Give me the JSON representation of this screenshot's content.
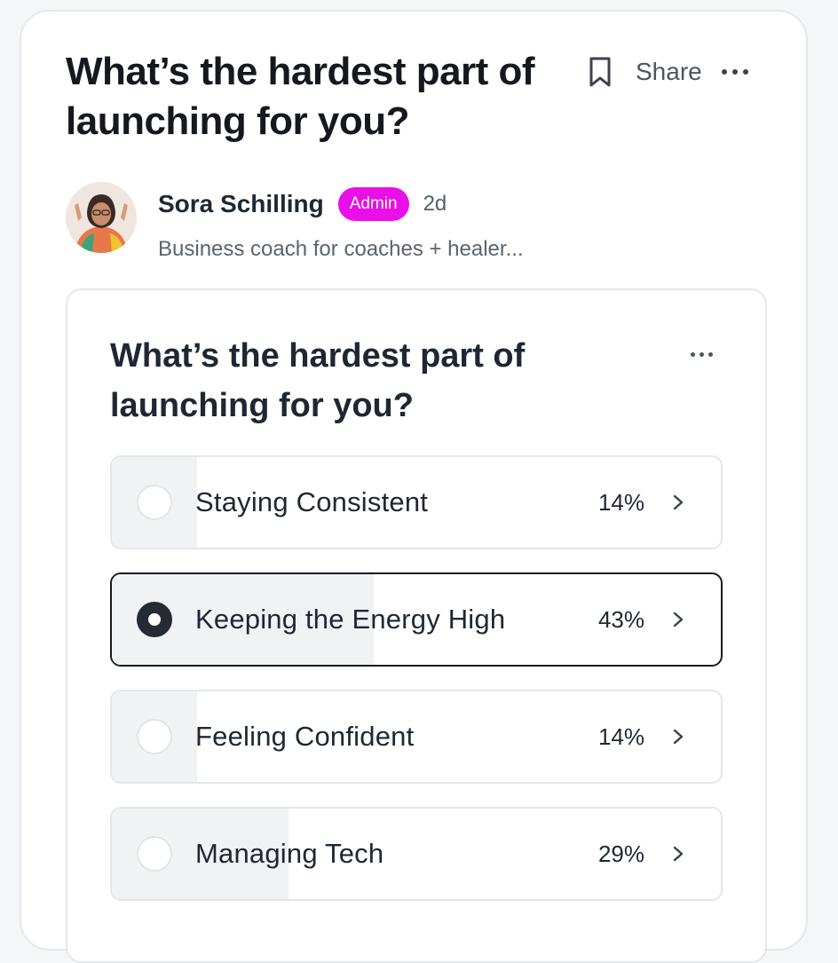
{
  "post": {
    "title": "What’s the hardest part of launching for you?",
    "share_label": "Share"
  },
  "author": {
    "name": "Sora Schilling",
    "badge": "Admin",
    "time": "2d",
    "bio": "Business coach for coaches + healer..."
  },
  "poll": {
    "question": "What’s the hardest part of launching for you?",
    "options": [
      {
        "label": "Staying Consistent",
        "percent_text": "14%",
        "percent": 14,
        "selected": false
      },
      {
        "label": "Keeping the Energy High",
        "percent_text": "43%",
        "percent": 43,
        "selected": true
      },
      {
        "label": "Feeling Confident",
        "percent_text": "14%",
        "percent": 14,
        "selected": false
      },
      {
        "label": "Managing Tech",
        "percent_text": "29%",
        "percent": 29,
        "selected": false
      }
    ]
  },
  "icons": {
    "bookmark": "bookmark-icon",
    "more": "more-horizontal-icon",
    "chevron": "chevron-right-icon"
  },
  "colors": {
    "admin_badge": "#ea0ee8",
    "text_primary": "#1f2732",
    "bar_fill": "#f1f2f4"
  }
}
